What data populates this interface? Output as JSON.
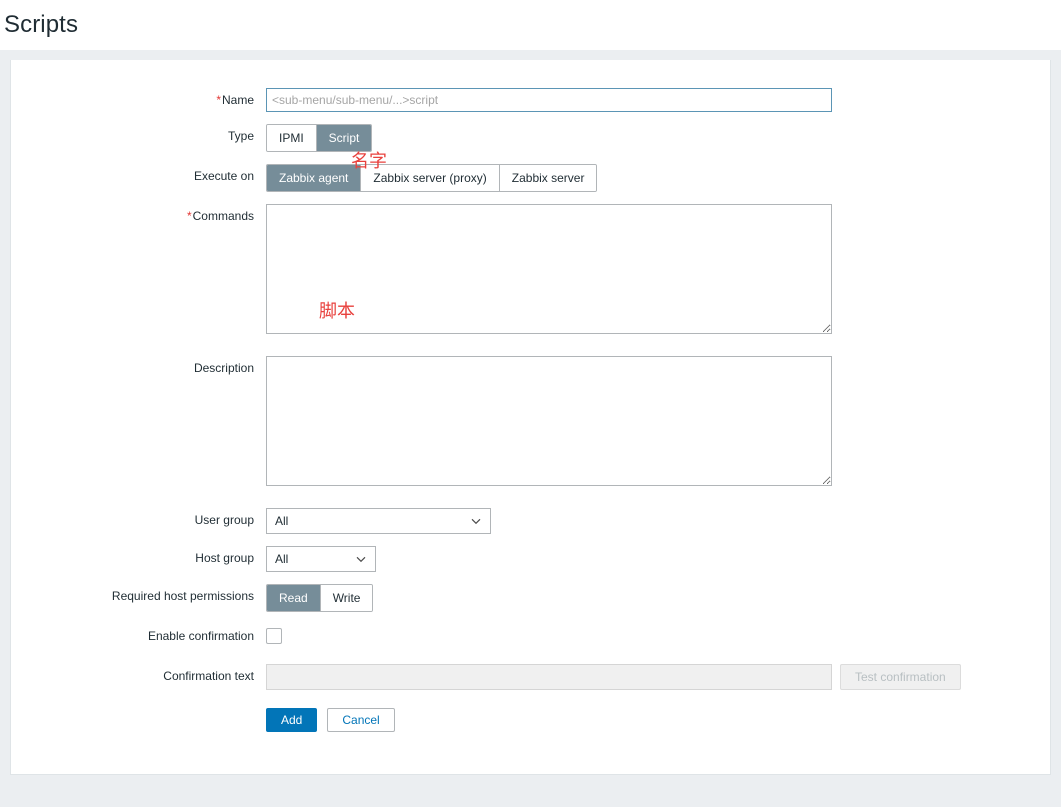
{
  "page": {
    "title": "Scripts"
  },
  "form": {
    "name": {
      "label": "Name",
      "required": true,
      "value": "",
      "placeholder": "<sub-menu/sub-menu/...>script"
    },
    "type": {
      "label": "Type",
      "options": [
        "IPMI",
        "Script"
      ],
      "selected": "Script"
    },
    "execute_on": {
      "label": "Execute on",
      "options": [
        "Zabbix agent",
        "Zabbix server (proxy)",
        "Zabbix server"
      ],
      "selected": "Zabbix agent"
    },
    "commands": {
      "label": "Commands",
      "required": true,
      "value": ""
    },
    "description": {
      "label": "Description",
      "value": ""
    },
    "user_group": {
      "label": "User group",
      "value": "All",
      "options": [
        "All"
      ]
    },
    "host_group": {
      "label": "Host group",
      "value": "All",
      "options": [
        "All"
      ]
    },
    "host_permissions": {
      "label": "Required host permissions",
      "options": [
        "Read",
        "Write"
      ],
      "selected": "Read"
    },
    "enable_confirmation": {
      "label": "Enable confirmation",
      "checked": false
    },
    "confirmation_text": {
      "label": "Confirmation text",
      "value": "",
      "placeholder": "",
      "disabled": true
    },
    "test_confirmation": {
      "label": "Test confirmation",
      "disabled": true
    }
  },
  "actions": {
    "submit_label": "Add",
    "cancel_label": "Cancel"
  },
  "annotations": {
    "name_note": "名字",
    "commands_note": "脚本"
  },
  "colors": {
    "accent_blue": "#0275b8",
    "toggle_selected": "#768d99",
    "annotation_red": "#e8413d",
    "required_red": "#e33734",
    "page_bg": "#ebeef1"
  }
}
